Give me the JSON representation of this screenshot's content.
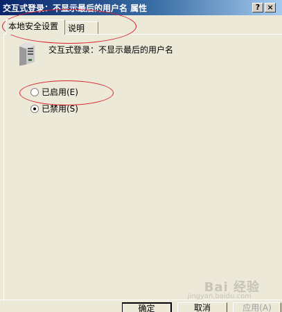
{
  "window": {
    "title": "交互式登录：不显示最后的用户名 属性",
    "help_button": "?",
    "close_button": "×"
  },
  "tabs": [
    {
      "label": "本地安全设置",
      "active": true
    },
    {
      "label": "说明",
      "active": false
    }
  ],
  "policy": {
    "name": "交互式登录：不显示最后的用户名",
    "icon": "server-icon"
  },
  "options": {
    "enabled": {
      "label": "已启用(E)",
      "selected": false
    },
    "disabled": {
      "label": "已禁用(S)",
      "selected": true
    }
  },
  "buttons": {
    "ok": "确定",
    "cancel": "取消",
    "apply": "应用(A)"
  },
  "watermark": {
    "logo": "Bai 经验",
    "url": "jingyan.baidu.com"
  },
  "colors": {
    "annotation": "#d8202a",
    "title_bar": "#0a246a"
  }
}
